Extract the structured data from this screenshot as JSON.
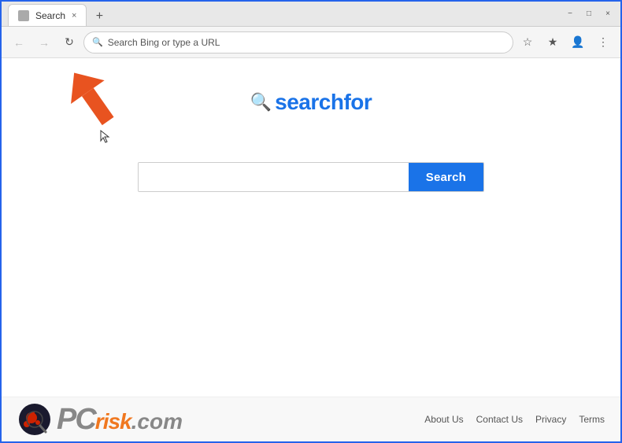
{
  "browser": {
    "title": "Search",
    "tab_label": "Search",
    "new_tab_label": "+",
    "address_placeholder": "Search Bing or type a URL",
    "address_value": "Search Bing or type a URL",
    "window_minimize": "−",
    "window_maximize": "□",
    "window_close": "×"
  },
  "nav": {
    "back_label": "←",
    "forward_label": "→",
    "refresh_label": "↻",
    "favorites_label": "☆",
    "extensions_label": "★",
    "profile_label": "👤",
    "more_label": "⋮"
  },
  "logo": {
    "icon": "🔍",
    "text_prefix": "search",
    "text_suffix": "for"
  },
  "search": {
    "placeholder": "",
    "button_label": "Search"
  },
  "footer": {
    "brand_pc": "PC",
    "brand_risk": "risk",
    "brand_dotcom": ".com",
    "links": [
      {
        "label": "About Us",
        "key": "about-us"
      },
      {
        "label": "Contact Us",
        "key": "contact-us"
      },
      {
        "label": "Privacy",
        "key": "privacy"
      },
      {
        "label": "Terms",
        "key": "terms"
      }
    ]
  },
  "annotation": {
    "arrow_color": "#e85320"
  }
}
